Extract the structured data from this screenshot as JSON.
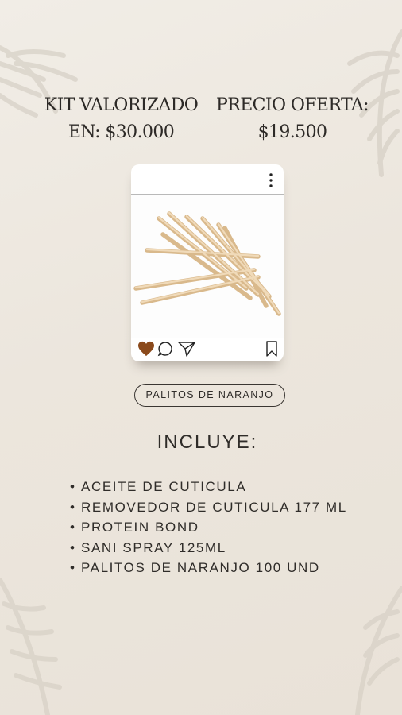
{
  "prices": {
    "valued": {
      "line1": "KIT VALORIZADO",
      "line2": "EN: $30.000"
    },
    "offer": {
      "line1": "PRECIO OFERTA:",
      "line2": "$19.500"
    }
  },
  "post": {
    "image_subject": "orange-wood-sticks",
    "icons": [
      "more-vertical-icon",
      "heart-icon",
      "comment-icon",
      "share-icon",
      "bookmark-icon"
    ],
    "heart_color": "#8b4a1c"
  },
  "tag": {
    "label": "PALITOS DE NARANJO"
  },
  "includes": {
    "title": "INCLUYE:",
    "bullet": "•",
    "items": [
      "ACEITE DE CUTICULA",
      "REMOVEDOR DE CUTICULA 177 ML",
      "PROTEIN BOND",
      "SANI SPRAY 125ML",
      "PALITOS DE NARANJO 100 UND"
    ]
  },
  "colors": {
    "background": "#ede8e0",
    "text": "#2d2a27",
    "stick": "#e8cda6"
  }
}
